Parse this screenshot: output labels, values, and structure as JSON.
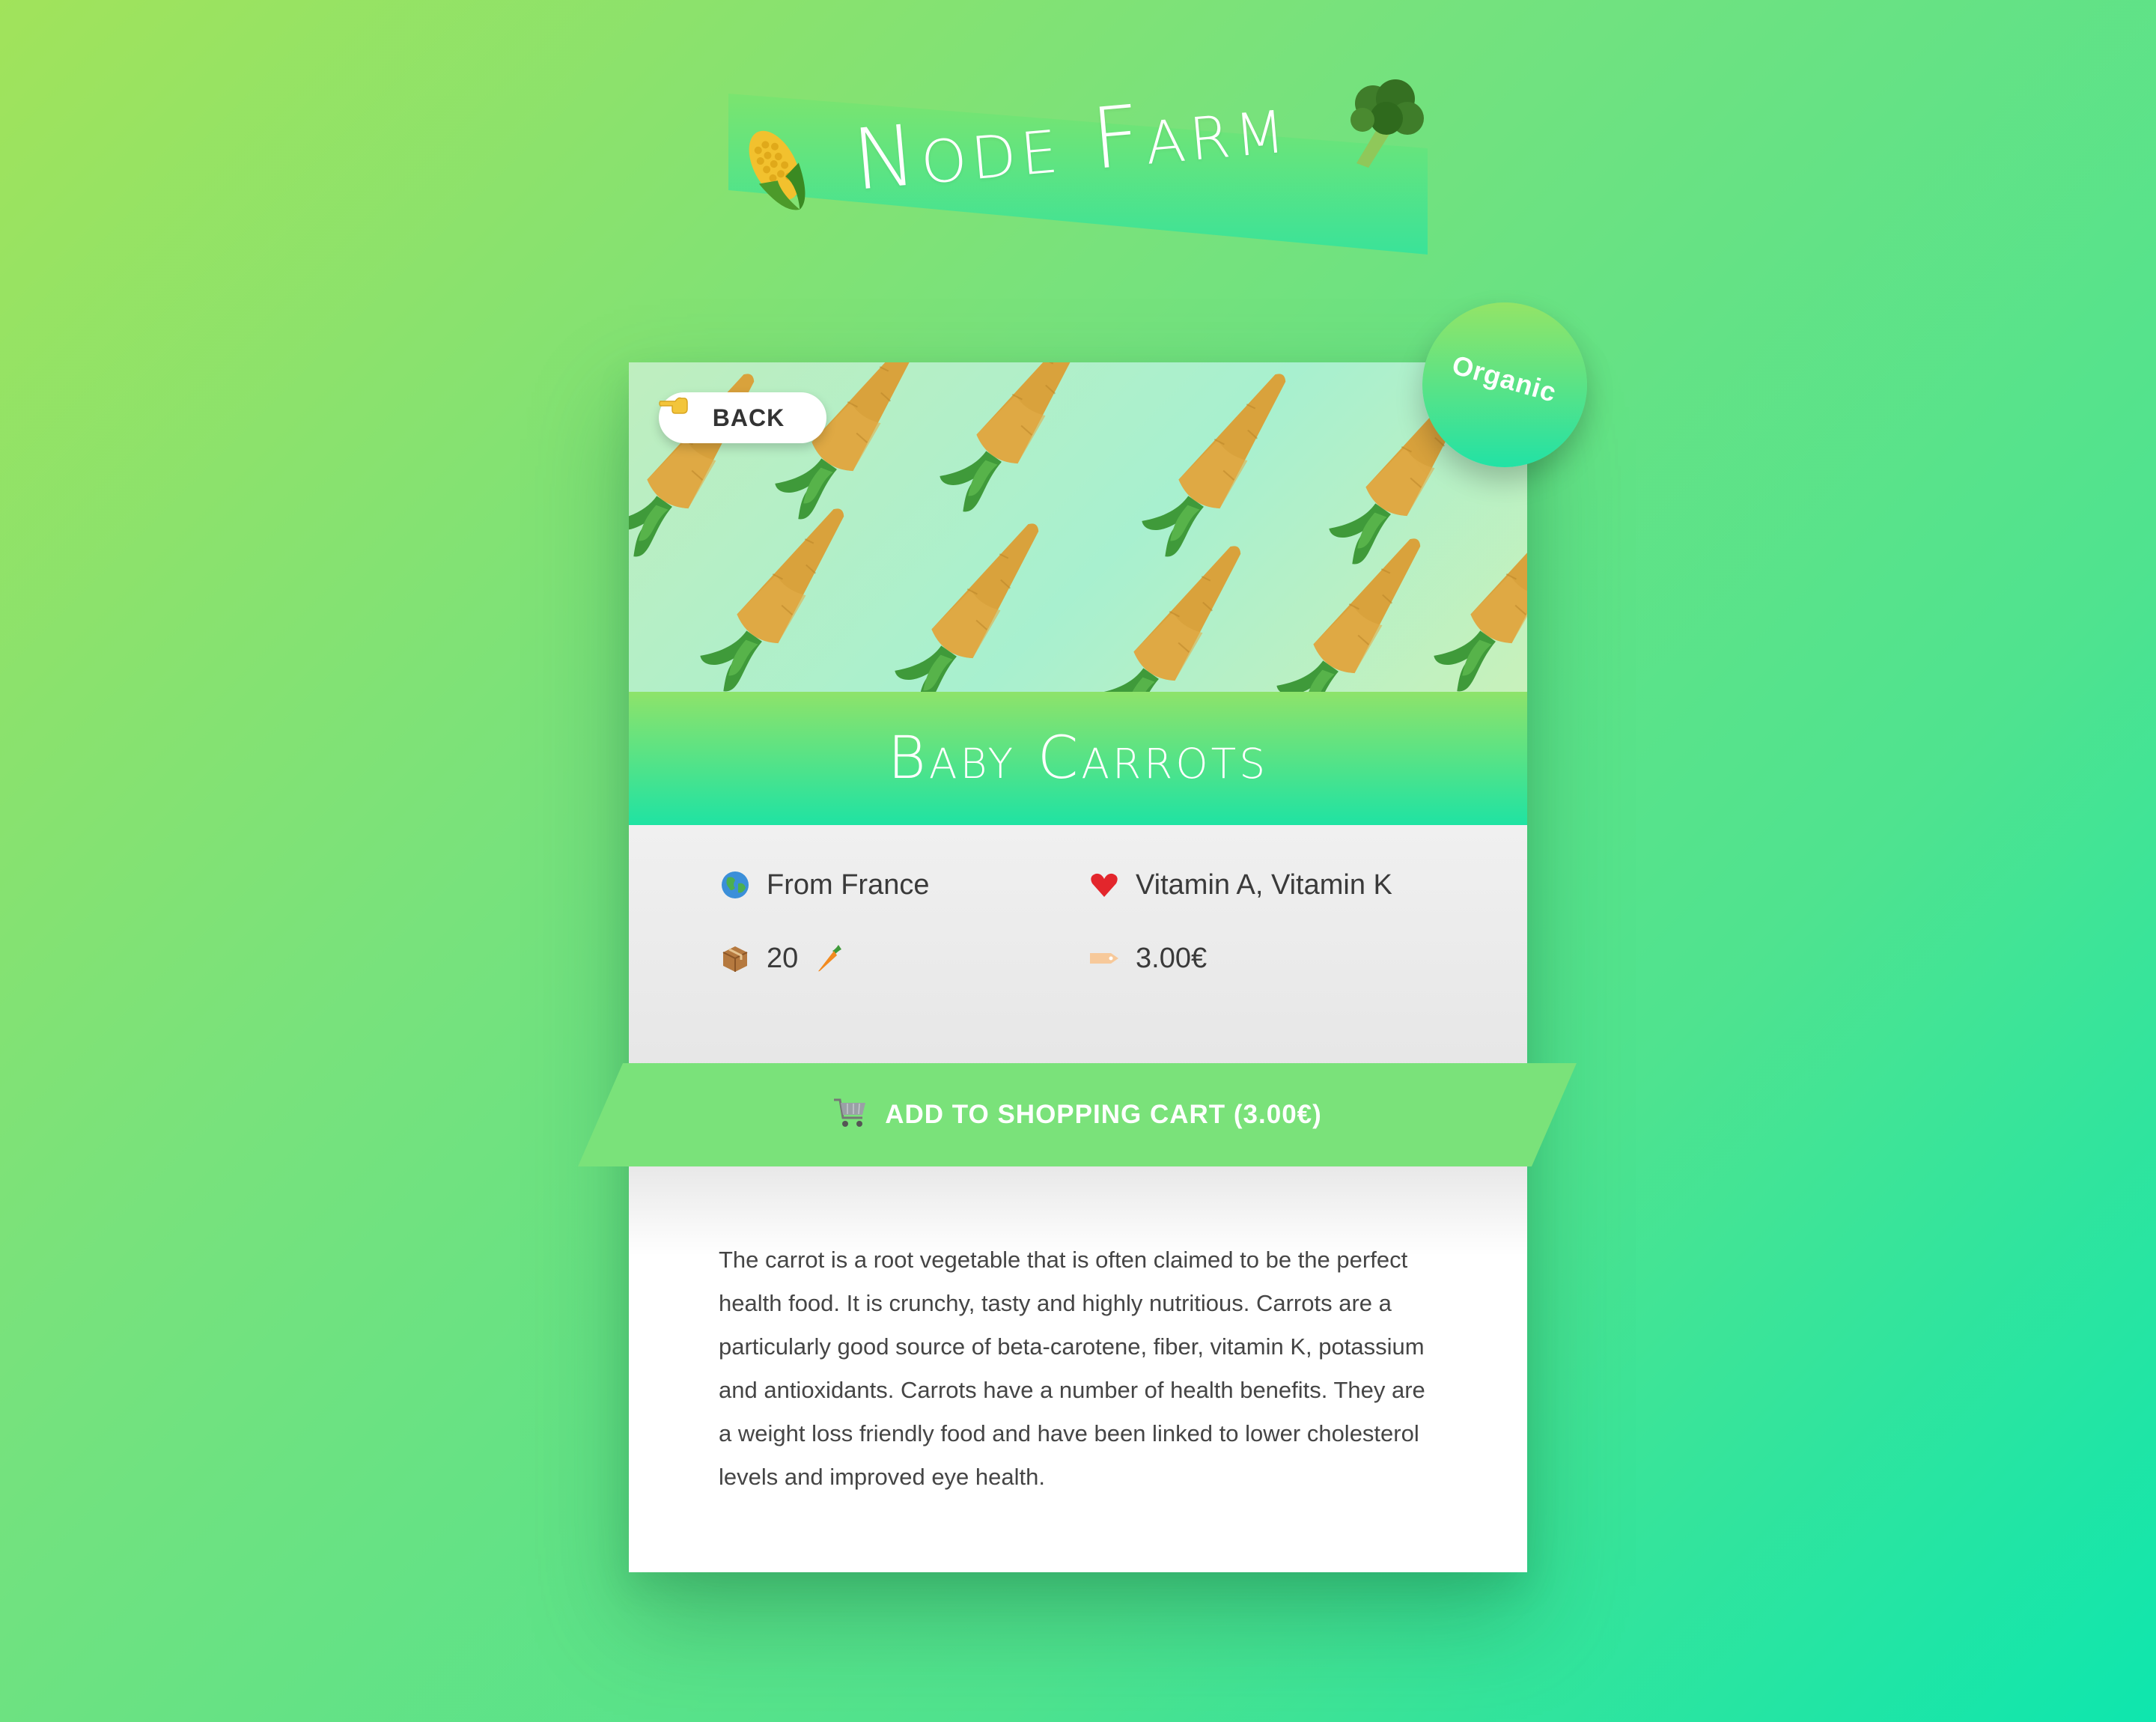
{
  "header": {
    "title": "Node Farm",
    "left_icon": "corn-icon",
    "right_icon": "broccoli-icon"
  },
  "product": {
    "name": "Baby Carrots",
    "badge": "Organic",
    "back_label": "BACK",
    "from_label": "From France",
    "vitamins_label": "Vitamin A, Vitamin K",
    "quantity": "20",
    "price": "3.00€",
    "cart_button_label": "ADD TO SHOPPING CART (3.00€)",
    "description": "The carrot is a root vegetable that is often claimed to be the perfect health food. It is crunchy, tasty and highly nutritious. Carrots are a particularly good source of beta-carotene, fiber, vitamin K, potassium and antioxidants. Carrots have a number of health benefits. They are a weight loss friendly food and have been linked to lower cholesterol levels and improved eye health."
  },
  "icons": {
    "back": "pointing-hand-left-icon",
    "origin": "globe-icon",
    "vitamins": "heart-icon",
    "quantity": "package-icon",
    "quantity_unit": "carrot-icon",
    "price": "price-tag-icon",
    "cart": "shopping-cart-icon"
  },
  "colors": {
    "background_start": "#a1e35b",
    "background_end": "#0ee6ae",
    "accent_green": "#7ae27a",
    "accent_teal": "#1fe3a3",
    "text_dark": "#3a3a3a"
  }
}
